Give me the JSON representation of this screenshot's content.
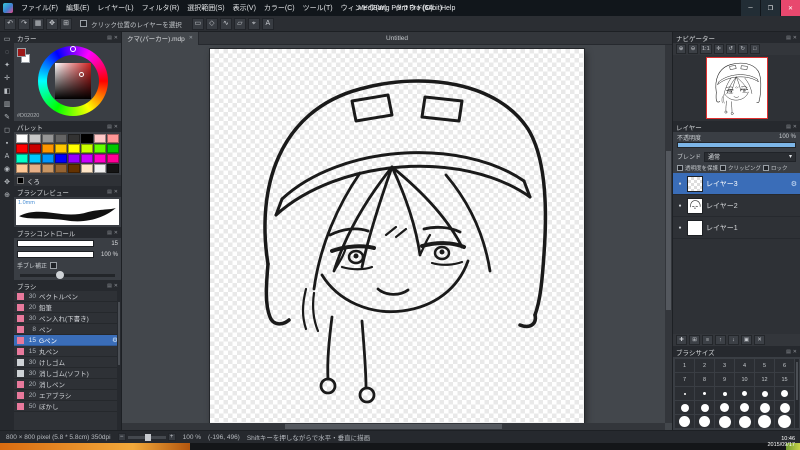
{
  "window": {
    "title": "MediBang Paint Pro (64bit)",
    "menus": [
      "ファイル(F)",
      "編集(E)",
      "レイヤー(L)",
      "フィルタ(R)",
      "選択範囲(S)",
      "表示(V)",
      "カラー(C)",
      "ツール(T)",
      "ウィンドウ(W)",
      "クラウド(O)",
      "Help"
    ],
    "controls": {
      "minimize": "─",
      "maximize": "❐",
      "close": "✕"
    }
  },
  "toolbar": {
    "icons": [
      "↶",
      "↷",
      "▦",
      "✥",
      "⊞"
    ],
    "checkbox_label": "クリック位置のレイヤーを選択",
    "right_icons": [
      "▭",
      "◇",
      "∿",
      "▱",
      "⌖",
      "A"
    ]
  },
  "tools": {
    "items": [
      {
        "name": "select",
        "glyph": "▭"
      },
      {
        "name": "lasso",
        "glyph": "◌"
      },
      {
        "name": "magic-wand",
        "glyph": "✦"
      },
      {
        "name": "move",
        "glyph": "✛"
      },
      {
        "name": "fill",
        "glyph": "◧"
      },
      {
        "name": "gradient",
        "glyph": "▥"
      },
      {
        "name": "brush",
        "glyph": "✎"
      },
      {
        "name": "eraser",
        "glyph": "◻"
      },
      {
        "name": "dot",
        "glyph": "▪"
      },
      {
        "name": "text",
        "glyph": "A"
      },
      {
        "name": "eyedropper",
        "glyph": "◉"
      },
      {
        "name": "hand",
        "glyph": "✥"
      },
      {
        "name": "zoom",
        "glyph": "⊕"
      }
    ]
  },
  "color_panel": {
    "title": "カラー",
    "hex": "#D02020"
  },
  "palette_panel": {
    "title": "パレット",
    "selected_color_name": "くろ",
    "colors": [
      "#ffffff",
      "#c8c8c8",
      "#969696",
      "#646464",
      "#323232",
      "#000000",
      "#ffc8c8",
      "#ff9696",
      "#ff0000",
      "#c80000",
      "#ff9600",
      "#ffc800",
      "#ffff00",
      "#c8ff00",
      "#64ff00",
      "#00c800",
      "#00ffc8",
      "#00c8ff",
      "#0096ff",
      "#0000ff",
      "#9600ff",
      "#c800ff",
      "#ff00c8",
      "#ff0096",
      "#ffc896",
      "#e6af87",
      "#c89664",
      "#966432",
      "#643200",
      "#ffe6c8",
      "#f0f0f0",
      "#141414"
    ]
  },
  "brush_preview_panel": {
    "title": "ブラシプレビュー",
    "size_label": "1.0mm"
  },
  "brush_control_panel": {
    "title": "ブラシコントロール",
    "size_value": "15",
    "opacity_value": "100 %",
    "stabilizer_label": "手ブレ補正"
  },
  "brush_panel": {
    "title": "ブラシ",
    "items": [
      {
        "size": "30",
        "name": "ベクトルペン",
        "chip": "#e8799c"
      },
      {
        "size": "20",
        "name": "鉛筆",
        "chip": "#e8799c"
      },
      {
        "size": "30",
        "name": "ペン入れ(下書き)",
        "chip": "#e8799c"
      },
      {
        "size": "8",
        "name": "ペン",
        "chip": "#e8799c"
      },
      {
        "size": "15",
        "name": "Gペン",
        "chip": "#e8799c"
      },
      {
        "size": "15",
        "name": "丸ペン",
        "chip": "#e8799c"
      },
      {
        "size": "30",
        "name": "けしゴム",
        "chip": "#cfd3d7"
      },
      {
        "size": "30",
        "name": "消しゴム(ソフト)",
        "chip": "#cfd3d7"
      },
      {
        "size": "20",
        "name": "消しペン",
        "chip": "#e8799c"
      },
      {
        "size": "20",
        "name": "エアブラシ",
        "chip": "#e8799c"
      },
      {
        "size": "50",
        "name": "ぼかし",
        "chip": "#e8799c"
      }
    ]
  },
  "canvas": {
    "tab_title": "クマ(パーカー).mdp",
    "window_title": "Untitled"
  },
  "navigator_panel": {
    "title": "ナビゲーター",
    "buttons": [
      "⊕",
      "⊖",
      "1:1",
      "✛",
      "↺",
      "↻",
      "□"
    ]
  },
  "layers_panel": {
    "title": "レイヤー",
    "opacity_label": "不透明度",
    "opacity_value": "100 %",
    "blend_label": "ブレンド",
    "blend_value": "通常",
    "protect_alpha_label": "透明度を保護",
    "clipping_label": "クリッピング",
    "lock_label": "ロック",
    "layers": [
      {
        "name": "レイヤー3"
      },
      {
        "name": "レイヤー2"
      },
      {
        "name": "レイヤー1"
      }
    ],
    "buttons": [
      "✚",
      "⊞",
      "≡",
      "↑",
      "↓",
      "▣",
      "✕"
    ]
  },
  "brush_size_panel": {
    "title": "ブラシサイズ",
    "numbers": [
      "1",
      "2",
      "3",
      "4",
      "5",
      "6",
      "7",
      "8",
      "9",
      "10",
      "12",
      "15"
    ]
  },
  "status_bar": {
    "document_info": "800 × 800 pixel (5.8 * 5.8cm)  350dpi",
    "zoom_value": "100 %",
    "coordinates": "(-196, 496)",
    "hint": "Shiftキーを押しながらで水平・垂直に描画"
  },
  "taskbar": {
    "time": "10:46",
    "date": "2015/09/17"
  },
  "icons": {
    "panel_menu": "▤",
    "panel_close": "✕",
    "gear": "⚙",
    "eye": "●",
    "chevron_down": "▾",
    "zoom_out": "−",
    "zoom_in": "+"
  },
  "colors": {
    "foreground": "#9c1818",
    "background": "#ffffff",
    "accent_blue": "#7db6e8",
    "selected_row": "#3a6db8",
    "close_button": "#e8486e",
    "navigator_border": "#e03030"
  }
}
